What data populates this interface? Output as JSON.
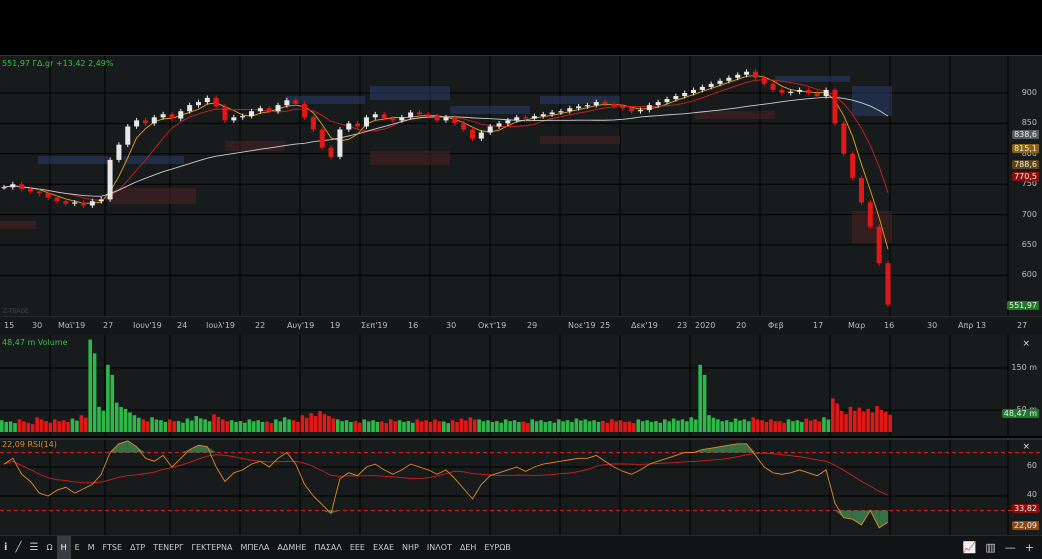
{
  "header": {
    "quote": "551,97 ΓΔ.gr +13,42 2,49%"
  },
  "watermark": "Z-TRADE",
  "price_axis": {
    "ticks": [
      "900",
      "850",
      "800",
      "750",
      "700",
      "650",
      "600"
    ],
    "tags": [
      {
        "text": "838,6",
        "color": "#555a5c"
      },
      {
        "text": "815,1",
        "color": "#8a6414"
      },
      {
        "text": "788,6",
        "color": "#5a4418"
      },
      {
        "text": "770,5",
        "color": "#8a1010"
      },
      {
        "text": "551,97",
        "color": "#1e7a2a"
      }
    ]
  },
  "x_axis": {
    "labels": [
      "15",
      "30",
      "Μαϊ'19",
      "27",
      "Ιουν'19",
      "24",
      "Ιουλ'19",
      "22",
      "Αυγ'19",
      "19",
      "Σεπ'19",
      "16",
      "30",
      "Οκτ'19",
      "29",
      "Νοε'19",
      "25",
      "Δεκ'19",
      "23",
      "2020",
      "20",
      "Φεβ",
      "17",
      "Μαρ",
      "16",
      "30",
      "Απρ 13",
      "27"
    ]
  },
  "volume": {
    "legend": "48,47 m Volume",
    "ticks": [
      "150 m",
      "50 m"
    ],
    "tag": "48,47 m",
    "close": "×"
  },
  "rsi": {
    "legend": "22,09 RSI(14)",
    "ticks": [
      "60",
      "40"
    ],
    "tags": [
      {
        "text": "33,82",
        "color": "#8a1010"
      },
      {
        "text": "22,09",
        "color": "#8a4a14"
      }
    ],
    "close": "×"
  },
  "toolbar": {
    "items": [
      "Ω",
      "Η",
      "Ε",
      "Μ",
      "FTSE",
      "ΔΤΡ",
      "ΤΕΝΕΡΓ",
      "ΓΕΚΤΕΡΝΑ",
      "ΜΠΕΛΑ",
      "ΑΔΜΗΕ",
      "ΠΑΣΑΛ",
      "ΕΕΕ",
      "ΕΧΑΕ",
      "ΝΗΡ",
      "ΙΝΛΟΤ",
      "ΔΕΗ",
      "ΕΥΡΩΒ"
    ],
    "active": "Η"
  },
  "colors": {
    "up": "#2fb84a",
    "down": "#e01818",
    "ma_fast": "#e8a020",
    "ma_mid": "#d02020",
    "ma_slow": "#cccccc",
    "rsi": "#e08a2a"
  },
  "chart_data": {
    "type": "candlestick",
    "ylim": [
      533,
      957
    ],
    "closes": [
      745,
      750,
      742,
      738,
      735,
      728,
      722,
      718,
      720,
      715,
      722,
      725,
      790,
      815,
      845,
      855,
      850,
      860,
      865,
      858,
      870,
      880,
      885,
      892,
      878,
      855,
      860,
      862,
      870,
      875,
      870,
      880,
      888,
      882,
      860,
      840,
      810,
      795,
      840,
      850,
      845,
      860,
      865,
      858,
      855,
      860,
      868,
      865,
      862,
      855,
      860,
      850,
      840,
      825,
      835,
      845,
      850,
      855,
      860,
      858,
      862,
      865,
      868,
      870,
      875,
      878,
      880,
      885,
      882,
      878,
      875,
      870,
      872,
      880,
      885,
      890,
      895,
      900,
      905,
      910,
      915,
      920,
      925,
      930,
      935,
      925,
      915,
      905,
      900,
      902,
      905,
      900,
      895,
      905,
      850,
      800,
      760,
      720,
      680,
      620,
      552
    ],
    "volumes_m": [
      28,
      25,
      30,
      22,
      35,
      26,
      30,
      28,
      32,
      40,
      220,
      60,
      160,
      70,
      55,
      40,
      30,
      35,
      28,
      30,
      26,
      32,
      38,
      30,
      42,
      30,
      28,
      26,
      30,
      28,
      25,
      30,
      35,
      28,
      40,
      45,
      50,
      38,
      30,
      28,
      26,
      30,
      28,
      25,
      30,
      28,
      26,
      30,
      28,
      30,
      25,
      28,
      32,
      35,
      30,
      28,
      26,
      30,
      28,
      25,
      30,
      28,
      26,
      30,
      28,
      32,
      30,
      28,
      26,
      30,
      28,
      25,
      30,
      28,
      26,
      30,
      32,
      30,
      35,
      160,
      40,
      30,
      28,
      32,
      30,
      35,
      28,
      30,
      26,
      30,
      28,
      32,
      30,
      35,
      80,
      50,
      60,
      58,
      55,
      62,
      48
    ],
    "vol_ylim": [
      0,
      240
    ],
    "rsi": [
      62,
      66,
      55,
      50,
      42,
      40,
      44,
      46,
      42,
      45,
      48,
      55,
      70,
      76,
      78,
      74,
      66,
      64,
      68,
      60,
      66,
      72,
      75,
      74,
      60,
      50,
      56,
      58,
      62,
      64,
      60,
      66,
      70,
      62,
      48,
      40,
      34,
      28,
      52,
      56,
      54,
      60,
      62,
      58,
      55,
      58,
      62,
      60,
      58,
      55,
      58,
      52,
      45,
      38,
      48,
      54,
      56,
      58,
      60,
      57,
      60,
      62,
      63,
      64,
      65,
      66,
      66,
      68,
      64,
      60,
      57,
      55,
      58,
      62,
      64,
      66,
      68,
      70,
      70,
      72,
      73,
      74,
      75,
      76,
      76,
      68,
      60,
      56,
      55,
      56,
      58,
      56,
      54,
      58,
      35,
      25,
      24,
      20,
      30,
      18,
      22
    ],
    "rsi_ylim": [
      15,
      78
    ]
  }
}
